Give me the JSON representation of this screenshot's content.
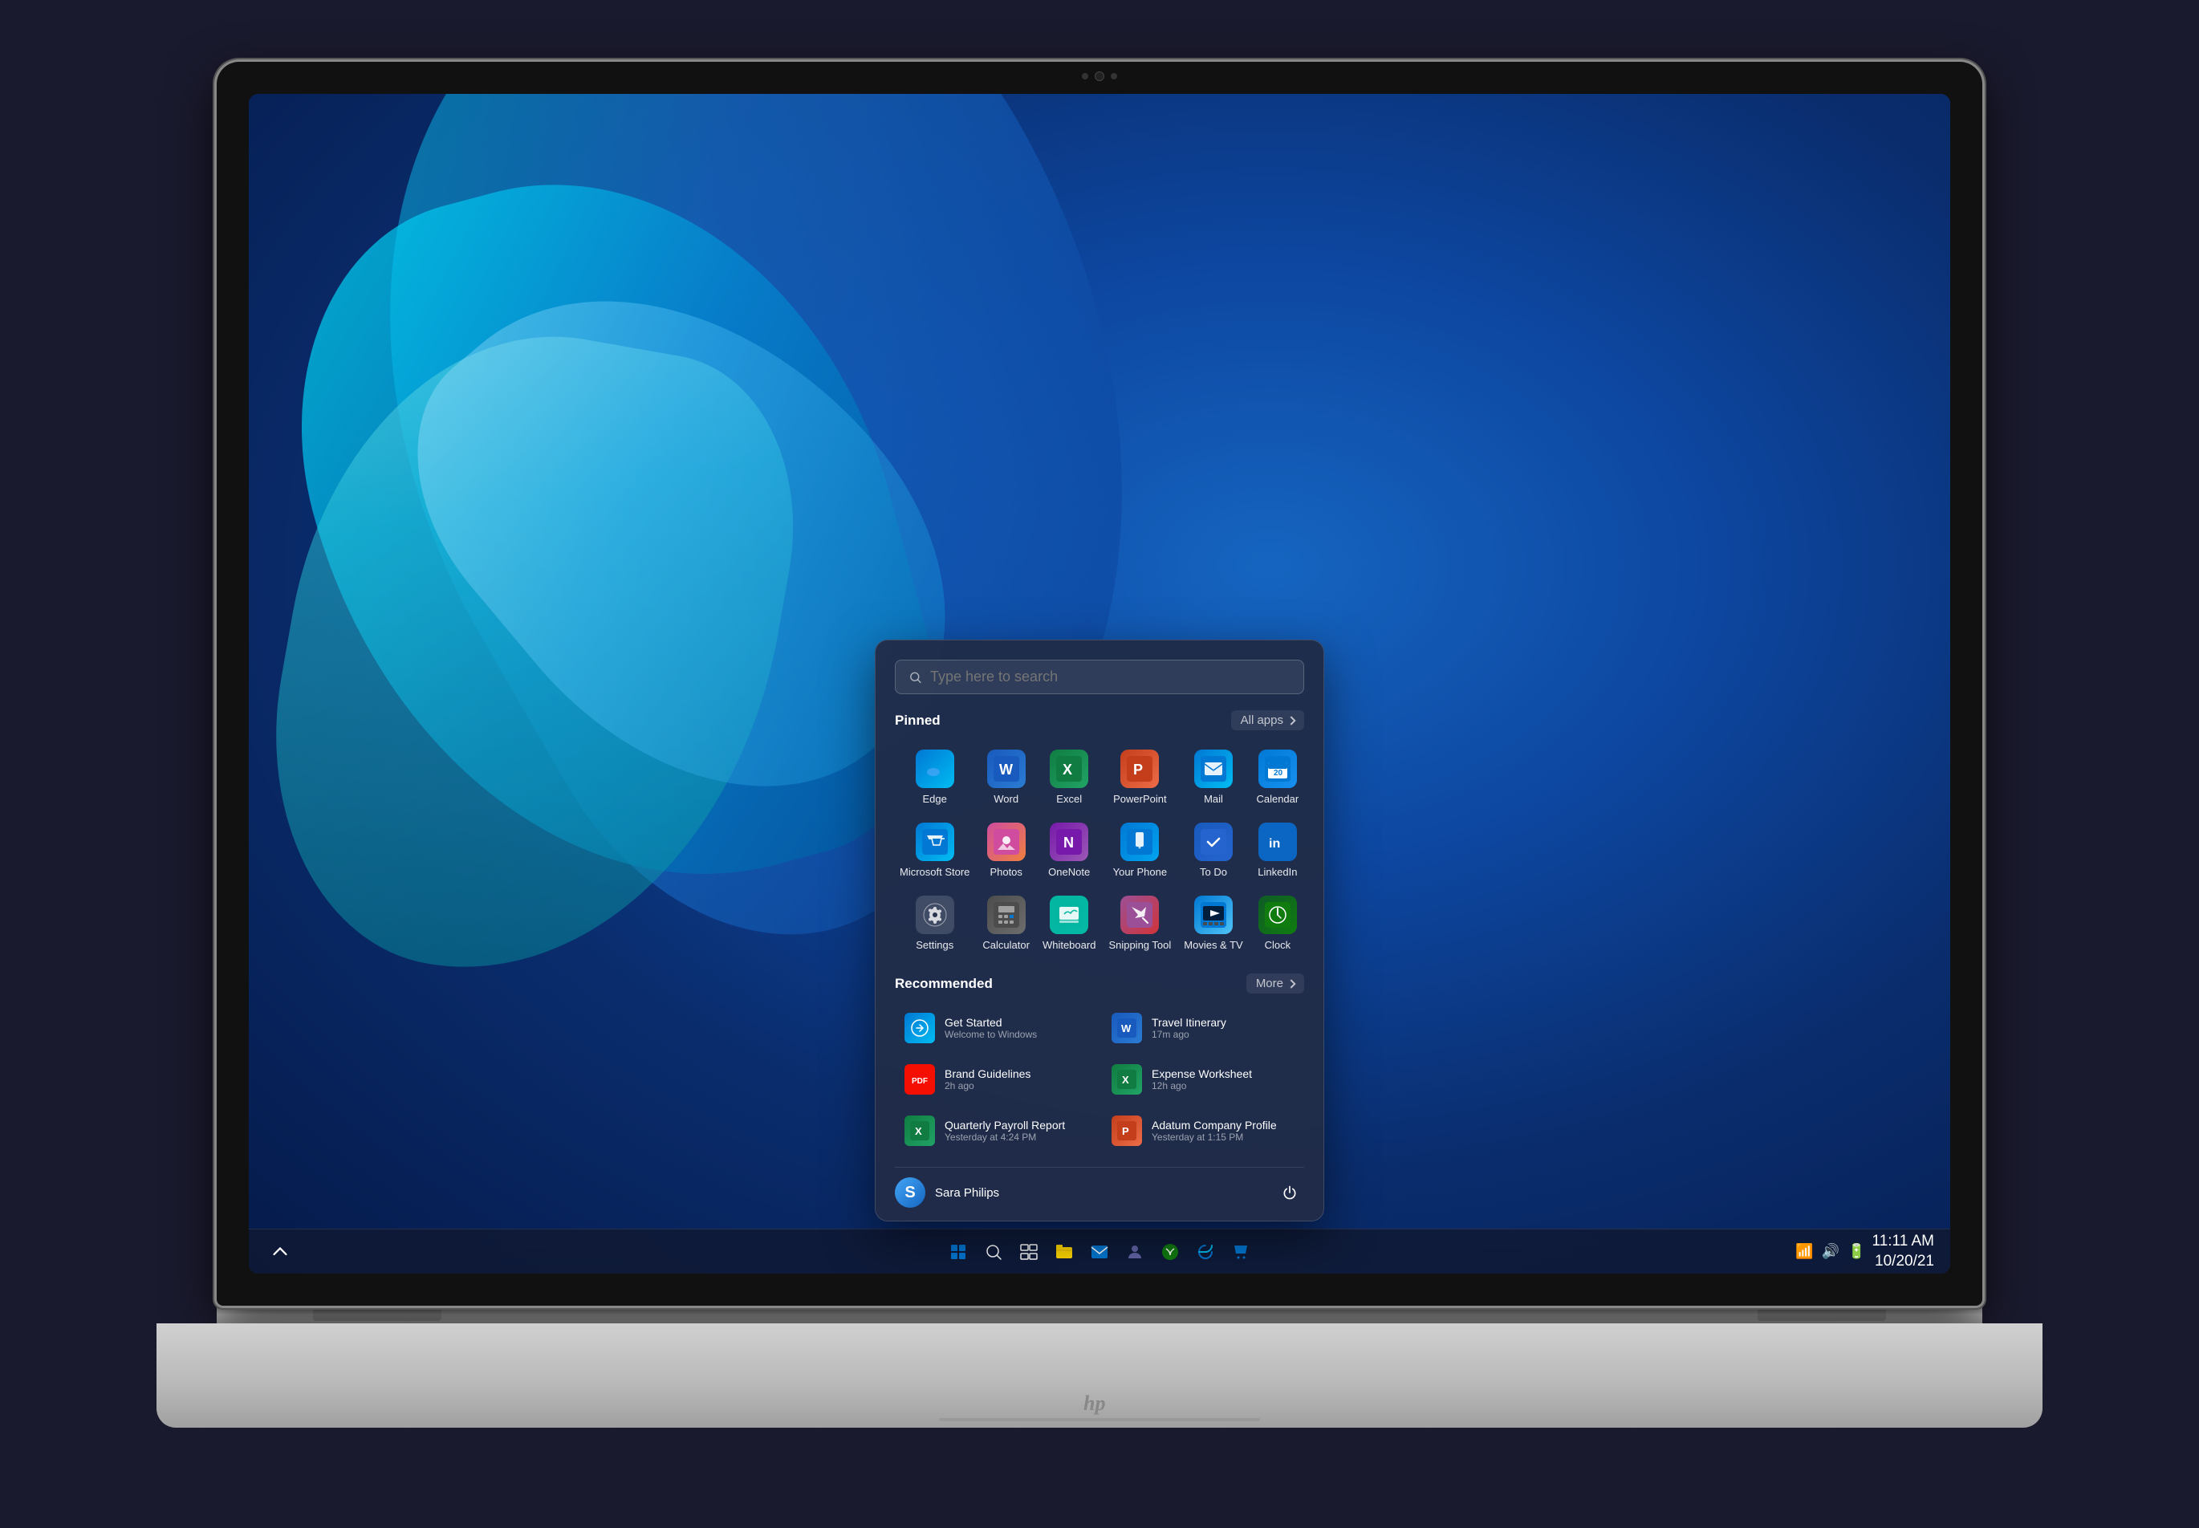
{
  "laptop": {
    "brand": "hp"
  },
  "wallpaper": {
    "style": "windows11-blue"
  },
  "taskbar": {
    "start_icon": "⊞",
    "search_icon": "🔍",
    "taskview_icon": "⧉",
    "pinned_apps": [
      "edge",
      "explorer",
      "mail",
      "teams",
      "xbox",
      "edge2",
      "store"
    ],
    "system_tray": {
      "chevron": "^",
      "wifi": "wifi",
      "volume": "🔊",
      "battery": "🔋",
      "date": "10/20/21",
      "time": "11:11 AM"
    }
  },
  "start_menu": {
    "search_placeholder": "Type here to search",
    "pinned_label": "Pinned",
    "all_apps_label": "All apps",
    "recommended_label": "Recommended",
    "more_label": "More",
    "pinned_apps": [
      {
        "id": "edge",
        "label": "Edge",
        "icon_class": "icon-edge",
        "symbol": ""
      },
      {
        "id": "word",
        "label": "Word",
        "icon_class": "icon-word",
        "symbol": "W"
      },
      {
        "id": "excel",
        "label": "Excel",
        "icon_class": "icon-excel",
        "symbol": "X"
      },
      {
        "id": "powerpoint",
        "label": "PowerPoint",
        "icon_class": "icon-powerpoint",
        "symbol": "P"
      },
      {
        "id": "mail",
        "label": "Mail",
        "icon_class": "icon-mail",
        "symbol": "✉"
      },
      {
        "id": "calendar",
        "label": "Calendar",
        "icon_class": "icon-calendar",
        "symbol": "📅"
      },
      {
        "id": "store",
        "label": "Microsoft Store",
        "icon_class": "icon-store",
        "symbol": "🛍"
      },
      {
        "id": "photos",
        "label": "Photos",
        "icon_class": "icon-photos",
        "symbol": "🖼"
      },
      {
        "id": "onenote",
        "label": "OneNote",
        "icon_class": "icon-onenote",
        "symbol": "N"
      },
      {
        "id": "yourphone",
        "label": "Your Phone",
        "icon_class": "icon-yourphone",
        "symbol": "📱"
      },
      {
        "id": "todo",
        "label": "To Do",
        "icon_class": "icon-todo",
        "symbol": "✓"
      },
      {
        "id": "linkedin",
        "label": "LinkedIn",
        "icon_class": "icon-linkedin",
        "symbol": "in"
      },
      {
        "id": "settings",
        "label": "Settings",
        "icon_class": "icon-settings",
        "symbol": "⚙"
      },
      {
        "id": "calculator",
        "label": "Calculator",
        "icon_class": "icon-calculator",
        "symbol": "="
      },
      {
        "id": "whiteboard",
        "label": "Whiteboard",
        "icon_class": "icon-whiteboard",
        "symbol": "🖊"
      },
      {
        "id": "snipping",
        "label": "Snipping Tool",
        "icon_class": "icon-snipping",
        "symbol": "✂"
      },
      {
        "id": "movies",
        "label": "Movies & TV",
        "icon_class": "icon-movies",
        "symbol": "▶"
      },
      {
        "id": "clock",
        "label": "Clock",
        "icon_class": "icon-clock",
        "symbol": "🕐"
      }
    ],
    "recommended_items": [
      {
        "id": "get-started",
        "name": "Get Started",
        "subtitle": "Welcome to Windows",
        "icon_class": "icon-rec-getstarted",
        "symbol": "🌟"
      },
      {
        "id": "travel-itinerary",
        "name": "Travel Itinerary",
        "subtitle": "17m ago",
        "icon_class": "icon-rec-word",
        "symbol": "W"
      },
      {
        "id": "brand-guidelines",
        "name": "Brand Guidelines",
        "subtitle": "2h ago",
        "icon_class": "icon-rec-pdf",
        "symbol": "P"
      },
      {
        "id": "expense-worksheet",
        "name": "Expense Worksheet",
        "subtitle": "12h ago",
        "icon_class": "icon-rec-excel",
        "symbol": "X"
      },
      {
        "id": "quarterly-payroll",
        "name": "Quarterly Payroll Report",
        "subtitle": "Yesterday at 4:24 PM",
        "icon_class": "icon-rec-excel",
        "symbol": "X"
      },
      {
        "id": "adatum-company",
        "name": "Adatum Company Profile",
        "subtitle": "Yesterday at 1:15 PM",
        "icon_class": "icon-rec-ppt",
        "symbol": "P"
      }
    ],
    "user": {
      "name": "Sara Philips",
      "avatar_text": "S"
    },
    "power_symbol": "⏻"
  }
}
